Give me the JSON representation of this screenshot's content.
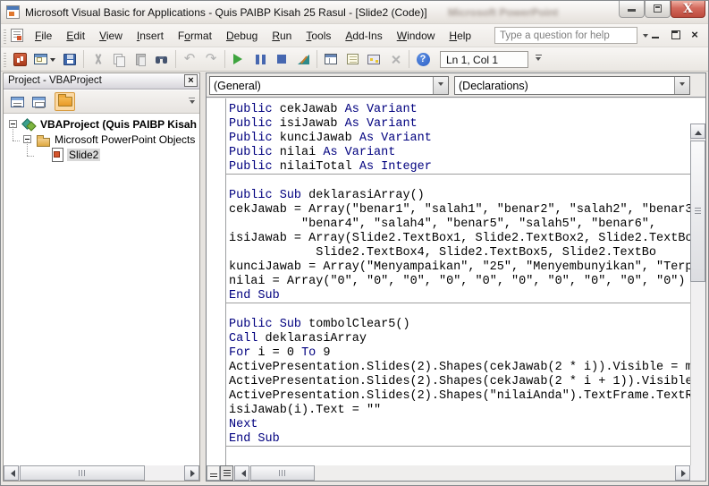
{
  "window": {
    "title": "Microsoft Visual Basic for Applications - Quis PAIBP Kisah 25 Rasul - [Slide2 (Code)]",
    "ghost_text": "Microsoft PowerPoint"
  },
  "menubar": {
    "items": [
      {
        "label": "File",
        "accel": 0
      },
      {
        "label": "Edit",
        "accel": 0
      },
      {
        "label": "View",
        "accel": 0
      },
      {
        "label": "Insert",
        "accel": 0
      },
      {
        "label": "Format",
        "accel": 1
      },
      {
        "label": "Debug",
        "accel": 0
      },
      {
        "label": "Run",
        "accel": 0
      },
      {
        "label": "Tools",
        "accel": 0
      },
      {
        "label": "Add-Ins",
        "accel": 0
      },
      {
        "label": "Window",
        "accel": 0
      },
      {
        "label": "Help",
        "accel": 0
      }
    ],
    "help_placeholder": "Type a question for help"
  },
  "toolbar": {
    "buttons": [
      "view-powerpoint",
      "insert-userform",
      "save",
      "cut",
      "copy",
      "paste",
      "find",
      "undo",
      "redo",
      "run-sub",
      "break",
      "reset",
      "design-mode",
      "project-explorer",
      "properties-window",
      "object-browser",
      "toolbox",
      "help"
    ],
    "disabled_buttons": [
      "cut",
      "copy",
      "paste",
      "undo",
      "redo",
      "toolbox"
    ],
    "position_indicator": "Ln 1, Col 1"
  },
  "project_panel": {
    "title": "Project - VBAProject",
    "toolbar_buttons": [
      "view-code",
      "view-object",
      "toggle-folders"
    ],
    "tree": [
      {
        "label": "VBAProject (Quis PAIBP Kisah",
        "icon": "project-icon",
        "level": 0,
        "bold": true,
        "expander": "minus",
        "selected": false
      },
      {
        "label": "Microsoft PowerPoint Objects",
        "icon": "folder-icon",
        "level": 1,
        "bold": false,
        "expander": "minus",
        "selected": false
      },
      {
        "label": "Slide2",
        "icon": "slide-icon",
        "level": 2,
        "bold": false,
        "expander": "none",
        "selected": true
      }
    ]
  },
  "code_window": {
    "object_dropdown": "(General)",
    "procedure_dropdown": "(Declarations)",
    "keywords": [
      "Public",
      "Sub",
      "End",
      "As",
      "Variant",
      "Integer",
      "Call",
      "For",
      "To",
      "Next"
    ],
    "keyword_color": "#00007F",
    "lines": [
      {
        "text": "Public cekJawab As Variant"
      },
      {
        "text": "Public isiJawab As Variant"
      },
      {
        "text": "Public kunciJawab As Variant"
      },
      {
        "text": "Public nilai As Variant"
      },
      {
        "text": "Public nilaiTotal As Integer",
        "separator_after": true
      },
      {
        "text": ""
      },
      {
        "text": "Public Sub deklarasiArray()"
      },
      {
        "text": "cekJawab = Array(\"benar1\", \"salah1\", \"benar2\", \"salah2\", \"benar3"
      },
      {
        "text": "          \"benar4\", \"salah4\", \"benar5\", \"salah5\", \"benar6\","
      },
      {
        "text": "isiJawab = Array(Slide2.TextBox1, Slide2.TextBox2, Slide2.TextBo"
      },
      {
        "text": "            Slide2.TextBox4, Slide2.TextBox5, Slide2.TextBo"
      },
      {
        "text": "kunciJawab = Array(\"Menyampaikan\", \"25\", \"Menyembunyikan\", \"Terp"
      },
      {
        "text": "nilai = Array(\"0\", \"0\", \"0\", \"0\", \"0\", \"0\", \"0\", \"0\", \"0\", \"0\")"
      },
      {
        "text": "End Sub",
        "separator_after": true
      },
      {
        "text": ""
      },
      {
        "text": "Public Sub tombolClear5()"
      },
      {
        "text": "Call deklarasiArray"
      },
      {
        "text": "For i = 0 To 9"
      },
      {
        "text": "ActivePresentation.Slides(2).Shapes(cekJawab(2 * i)).Visible = m"
      },
      {
        "text": "ActivePresentation.Slides(2).Shapes(cekJawab(2 * i + 1)).Visible"
      },
      {
        "text": "ActivePresentation.Slides(2).Shapes(\"nilaiAnda\").TextFrame.TextR"
      },
      {
        "text": "isiJawab(i).Text = \"\""
      },
      {
        "text": "Next"
      },
      {
        "text": "End Sub",
        "separator_after": true
      },
      {
        "text": ""
      }
    ]
  },
  "colors": {
    "close_button_red": "#C75043",
    "selection_gray": "#D9D9D9",
    "folder_amber": "#EFA93C",
    "run_green": "#3EA43E"
  }
}
